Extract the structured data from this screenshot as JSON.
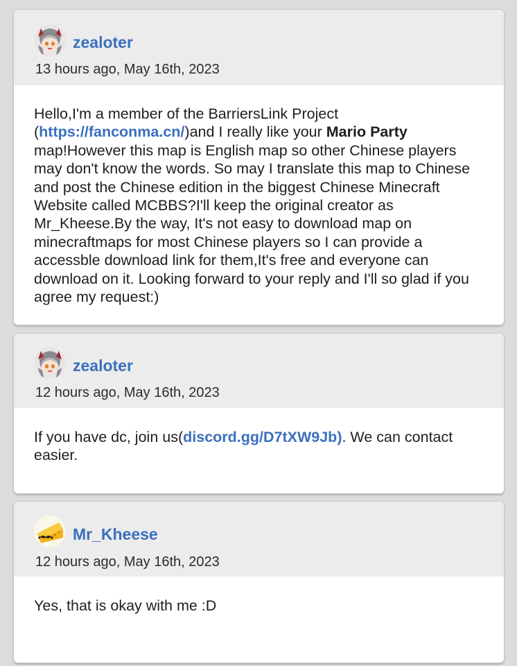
{
  "comments": [
    {
      "username": "zealoter",
      "avatar_icon": "anime-character-avatar-icon",
      "timestamp": "13 hours ago, May 16th, 2023",
      "body": {
        "t1": "Hello,I'm a member of the BarriersLink Project (",
        "link1": "https://fanconma.cn/",
        "t2": ")and I really like your ",
        "bold1": "Mario Party",
        "t3": " map!However this map is English map so other Chinese players may don't know the words. So may I translate this map to Chinese and post the Chinese edition in the biggest Chinese Minecraft Website called MCBBS?I'll keep the original creator as Mr_Kheese.By the way, It's not easy to download map on minecraftmaps for most Chinese players so I can provide a accessble download link for them,It's free and everyone can download on it. Looking forward to your reply and I'll so glad if you agree my request:)"
      }
    },
    {
      "username": "zealoter",
      "avatar_icon": "anime-character-avatar-icon",
      "timestamp": "12 hours ago, May 16th, 2023",
      "body": {
        "t1": "If you have dc, join us(",
        "link1": "discord.gg/D7tXW9Jb)",
        "t2": ". We can contact easier."
      }
    },
    {
      "username": "Mr_Kheese",
      "avatar_icon": "cheese-with-mustache-avatar-icon",
      "timestamp": "12 hours ago, May 16th, 2023",
      "body": {
        "t1": "Yes, that is okay with me :D"
      }
    }
  ],
  "colors": {
    "link": "#3a6fbd",
    "header_bg": "#ececec",
    "page_bg": "#dcdcdc"
  }
}
